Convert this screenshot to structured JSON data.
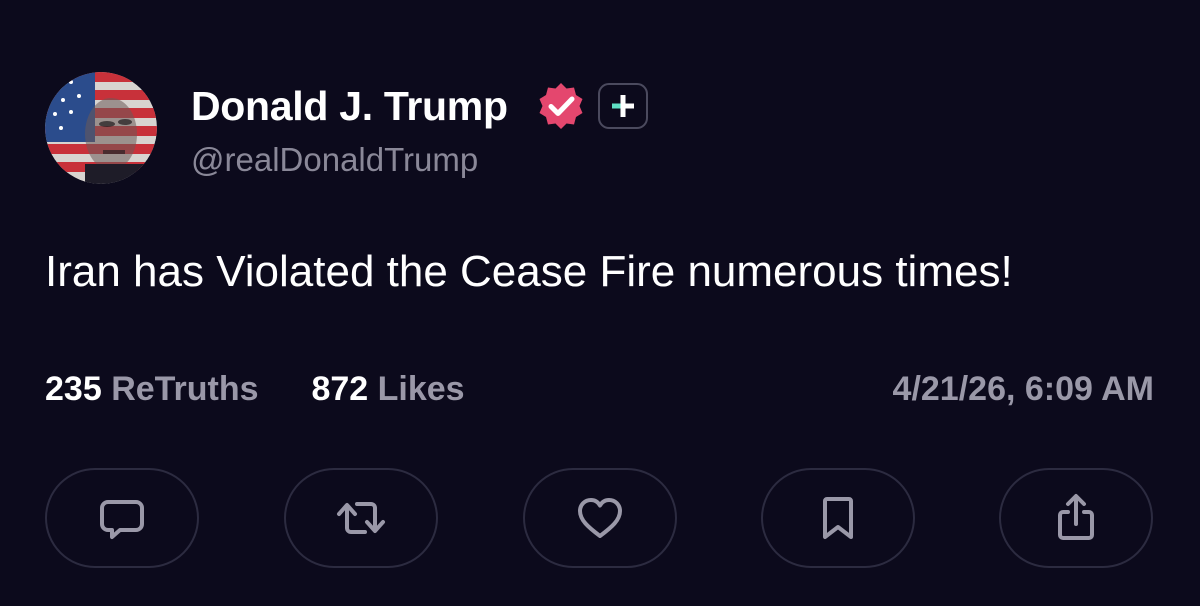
{
  "author": {
    "display_name": "Donald J. Trump",
    "handle": "@realDonaldTrump",
    "verified_icon": "verified-badge-icon",
    "plus_icon": "plus-badge-icon"
  },
  "post": {
    "text": "Iran has Violated the Cease Fire numerous times!"
  },
  "stats": {
    "retruths_count": "235",
    "retruths_label": "ReTruths",
    "likes_count": "872",
    "likes_label": "Likes",
    "timestamp": "4/21/26, 6:09 AM"
  },
  "actions": [
    {
      "name": "reply",
      "icon": "comment-icon"
    },
    {
      "name": "retruth",
      "icon": "repost-icon"
    },
    {
      "name": "like",
      "icon": "heart-icon"
    },
    {
      "name": "bookmark",
      "icon": "bookmark-icon"
    },
    {
      "name": "share",
      "icon": "share-icon"
    }
  ],
  "colors": {
    "background": "#0c0a1c",
    "text_primary": "#ffffff",
    "text_secondary": "#9a98a8",
    "verified": "#e4476e",
    "plus_accent": "#5fe0c4",
    "button_border": "#2c2b40"
  }
}
